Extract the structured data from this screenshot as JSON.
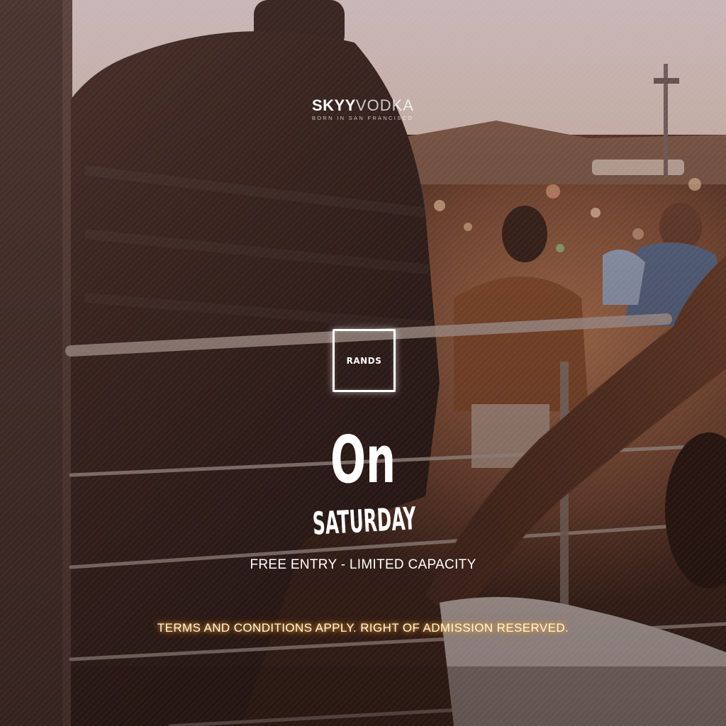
{
  "sponsor": {
    "brand_bold": "SKYY",
    "brand_light": "VODKA",
    "tagline": "BORN IN SAN FRANCISCO"
  },
  "venue_logo": {
    "text": "RANDS"
  },
  "headline": {
    "line1": "On",
    "line2": "SATURDAY"
  },
  "free_entry": "FREE ENTRY - LIMITED CAPACITY",
  "terms": "TERMS AND CONDITIONS APPLY. RIGHT OF ADMISSION RESERVED.",
  "colors": {
    "sky": "#c7b4b4",
    "shadow": "#2d1d18",
    "warm_accent": "#d48a55",
    "glow": "#ffb347"
  }
}
